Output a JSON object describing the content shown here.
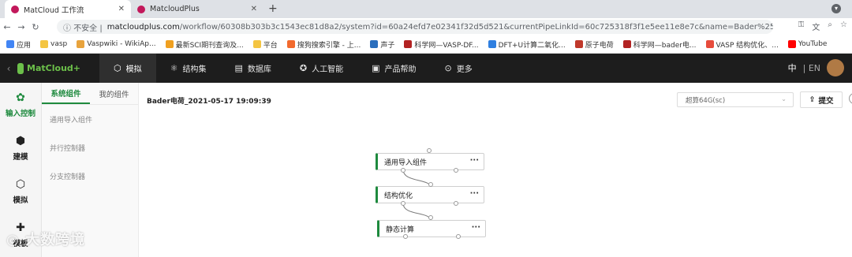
{
  "browser": {
    "tabs": [
      {
        "title": "MatCloud 工作流",
        "active": true
      },
      {
        "title": "MatcloudPlus",
        "active": false
      }
    ],
    "address": {
      "security": "不安全",
      "host": "matcloudplus.com",
      "path": "/workflow/60308b303b3c1543ec81d8a2/system?id=60a24efd7e02341f32d5d521&currentPipeLinkId=60c725318f3f1e5ee11e8e7c&name=Bader%25E7%2594%25B5%2..."
    },
    "bookmarks": [
      {
        "label": "应用",
        "color": "#4285f4"
      },
      {
        "label": "vasp",
        "color": "#f4c542"
      },
      {
        "label": "Vaspwiki - WikiAp...",
        "color": "#e8a33d"
      },
      {
        "label": "最新SCI期刊查询及...",
        "color": "#f0a020"
      },
      {
        "label": "平台",
        "color": "#f4c542"
      },
      {
        "label": "搜狗搜索引擎 - 上...",
        "color": "#f26a2e"
      },
      {
        "label": "声子",
        "color": "#2a6ebd"
      },
      {
        "label": "科学网—VASP-DF...",
        "color": "#b22222"
      },
      {
        "label": "DFT+U计算二氧化...",
        "color": "#2f7fe0"
      },
      {
        "label": "原子电荷",
        "color": "#c0392b"
      },
      {
        "label": "科学网—bader电...",
        "color": "#b22222"
      },
      {
        "label": "VASP 结构优化、...",
        "color": "#e74c3c"
      },
      {
        "label": "YouTube",
        "color": "#ff0000"
      }
    ]
  },
  "app": {
    "logo": "MatCloud+",
    "nav": [
      {
        "label": "模拟",
        "icon": "cube-icon",
        "active": true
      },
      {
        "label": "结构集",
        "icon": "molecule-icon",
        "active": false
      },
      {
        "label": "数据库",
        "icon": "database-icon",
        "active": false
      },
      {
        "label": "人工智能",
        "icon": "ai-icon",
        "active": false
      },
      {
        "label": "产品帮助",
        "icon": "help-icon",
        "active": false
      },
      {
        "label": "更多",
        "icon": "more-icon",
        "active": false
      }
    ],
    "lang_zh": "中",
    "lang_en": "EN"
  },
  "rail": [
    {
      "label": "输入控制",
      "icon": "input-control-icon",
      "active": true
    },
    {
      "label": "建模",
      "icon": "modeling-icon",
      "active": false
    },
    {
      "label": "模拟",
      "icon": "simulation-icon",
      "active": false
    },
    {
      "label": "模板",
      "icon": "template-icon",
      "active": false
    }
  ],
  "panel": {
    "tabs": [
      {
        "label": "系统组件",
        "active": true
      },
      {
        "label": "我的组件",
        "active": false
      }
    ],
    "items": [
      "通用导入组件",
      "并行控制器",
      "分支控制器"
    ]
  },
  "workspace": {
    "title": "Bader电荷_2021-05-17 19:09:39",
    "select_value": "超算64G(sc)",
    "submit_label": "提交",
    "nodes": [
      {
        "label": "通用导入组件"
      },
      {
        "label": "结构优化"
      },
      {
        "label": "静态计算"
      }
    ]
  },
  "watermark": "大数跨境",
  "colors": {
    "accent": "#1e8a3e",
    "header_bg": "#1d1d1d"
  }
}
